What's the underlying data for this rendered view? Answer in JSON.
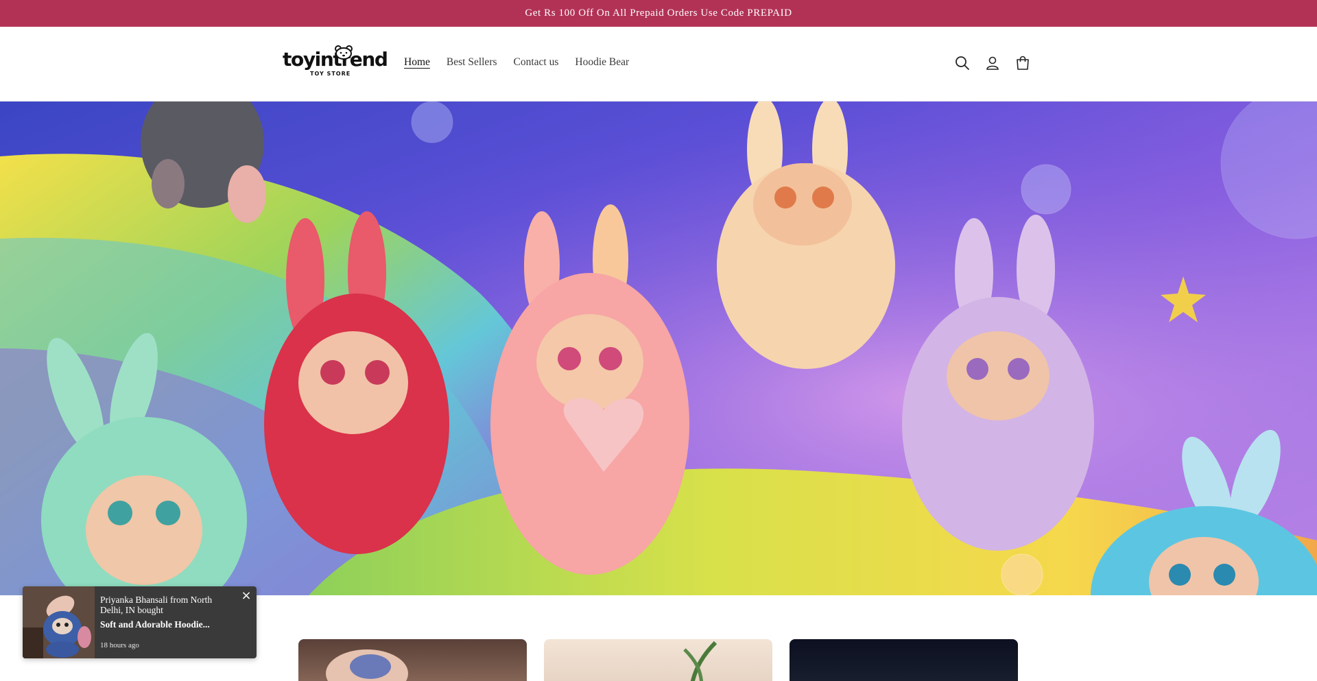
{
  "announcement": {
    "text": "Get Rs 100 Off On All Prepaid Orders Use Code PREPAID"
  },
  "header": {
    "logo": {
      "wordmark": "toyintrend",
      "tagline": "TOY STORE"
    },
    "nav": [
      {
        "label": "Home",
        "active": true
      },
      {
        "label": "Best Sellers",
        "active": false
      },
      {
        "label": "Contact us",
        "active": false
      },
      {
        "label": "Hoodie Bear",
        "active": false
      }
    ],
    "icons": [
      "search-icon",
      "account-icon",
      "cart-icon"
    ]
  },
  "hero": {
    "image": "banner of plush bunny toys on rainbow",
    "colors": {
      "sky": "#4b4cd0",
      "accent": "#f2c94c"
    }
  },
  "toast": {
    "who": "Priyanka Bhansali from North Delhi, IN bought",
    "product": "Soft and Adorable Hoodie...",
    "time": "18 hours ago",
    "close_icon": "close-icon"
  },
  "colors": {
    "announcement_bg": "#b23256",
    "toast_bg": "#3a3a3a"
  }
}
